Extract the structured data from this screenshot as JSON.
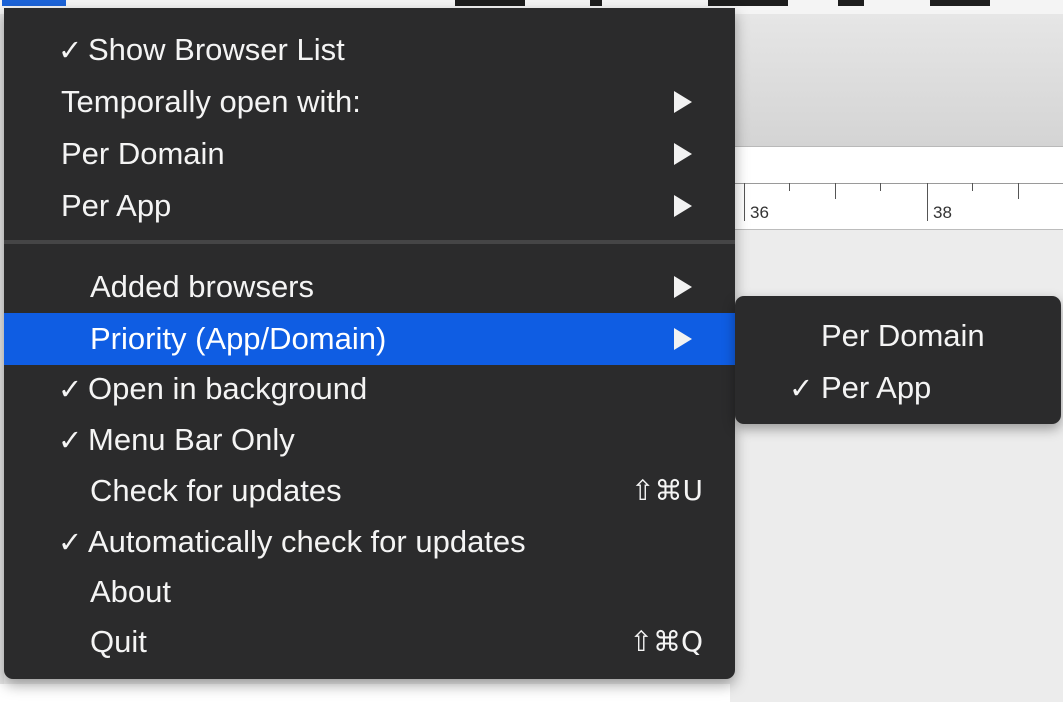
{
  "menubar": {
    "partial_text": "y    pp       "
  },
  "ruler": {
    "labels": [
      "36",
      "38"
    ]
  },
  "menu": {
    "items": [
      {
        "label": "Show Browser List",
        "checked": true,
        "submenu": false,
        "check": "✓"
      },
      {
        "label": "Temporally open with:",
        "checked": false,
        "submenu": true
      },
      {
        "label": "Per Domain",
        "checked": false,
        "submenu": true
      },
      {
        "label": "Per App",
        "checked": false,
        "submenu": true
      },
      {
        "label": "Added browsers",
        "checked": false,
        "submenu": true
      },
      {
        "label": "Priority (App/Domain)",
        "checked": false,
        "submenu": true,
        "highlighted": true
      },
      {
        "label": "Open in background",
        "checked": true,
        "submenu": false,
        "check": "✓"
      },
      {
        "label": "Menu Bar Only",
        "checked": true,
        "submenu": false,
        "check": "✓"
      },
      {
        "label": "Check for updates",
        "checked": false,
        "submenu": false,
        "shortcut": "⇧⌘U"
      },
      {
        "label": "Automatically check for updates",
        "checked": true,
        "submenu": false,
        "check": "✓"
      },
      {
        "label": "About",
        "checked": false,
        "submenu": false
      },
      {
        "label": "Quit",
        "checked": false,
        "submenu": false,
        "shortcut": "⇧⌘Q"
      }
    ]
  },
  "submenu": {
    "items": [
      {
        "label": "Per Domain",
        "checked": false
      },
      {
        "label": "Per App",
        "checked": true,
        "check": "✓"
      }
    ]
  },
  "colors": {
    "menu_background": "#2b2b2c",
    "highlight": "#0f5de3",
    "text": "#f4f4f4"
  }
}
